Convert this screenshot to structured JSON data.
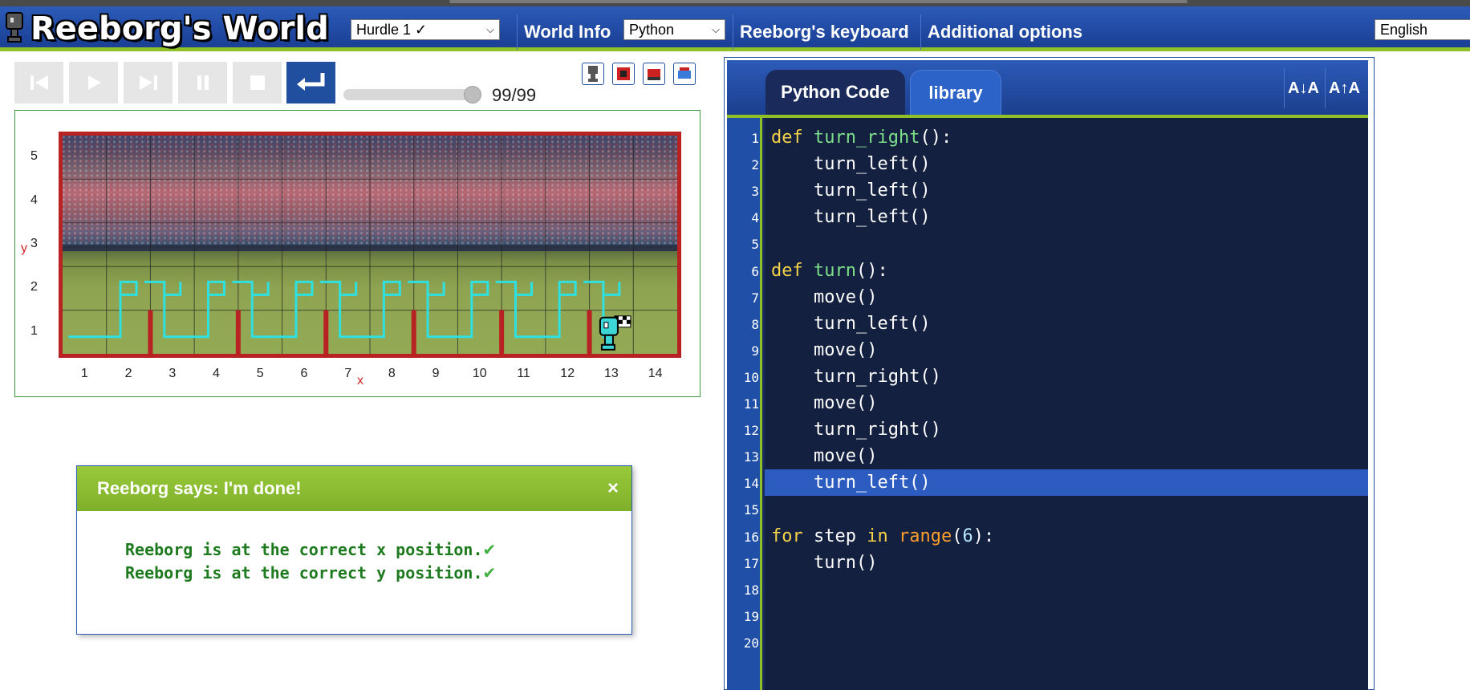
{
  "header": {
    "logo_text": "Reeborg's World",
    "world_select": "Hurdle 1 ✓",
    "world_info": "World Info",
    "language_select": "Python",
    "keyboard": "Reeborg's keyboard",
    "additional_options": "Additional options",
    "ui_language": "English"
  },
  "controls": {
    "counter": "99/99",
    "progress": 1.0
  },
  "world": {
    "y_axis_letter": "y",
    "x_axis_letter": "x",
    "rows": [
      "5",
      "4",
      "3",
      "2",
      "1"
    ],
    "columns": [
      "1",
      "2",
      "3",
      "4",
      "5",
      "6",
      "7",
      "8",
      "9",
      "10",
      "11",
      "12",
      "13",
      "14"
    ],
    "robot_position": {
      "x": 13,
      "y": 1
    },
    "goal_position": {
      "x": 13,
      "y": 1
    },
    "wall_colors": {
      "wall": "#b82222",
      "trace": "#2fe0e0"
    }
  },
  "dialog": {
    "title": "Reeborg says: I'm done!",
    "close": "×",
    "messages": [
      "Reeborg is at the correct x position.",
      "Reeborg is at the correct y position."
    ]
  },
  "editor": {
    "tabs": [
      "Python Code",
      "library"
    ],
    "font_decrease": "A↓A",
    "font_increase": "A↑A",
    "highlight_line": 14,
    "line_numbers": [
      "1",
      "2",
      "3",
      "4",
      "5",
      "6",
      "7",
      "8",
      "9",
      "10",
      "11",
      "12",
      "13",
      "14",
      "15",
      "16",
      "17",
      "18",
      "19",
      "20"
    ],
    "lines": [
      "def turn_right():",
      "    turn_left()",
      "    turn_left()",
      "    turn_left()",
      "",
      "def turn():",
      "    move()",
      "    turn_left()",
      "    move()",
      "    turn_right()",
      "    move()",
      "    turn_right()",
      "    move()",
      "    turn_left()",
      "",
      "for step in range(6):",
      "    turn()",
      "",
      "",
      ""
    ]
  }
}
